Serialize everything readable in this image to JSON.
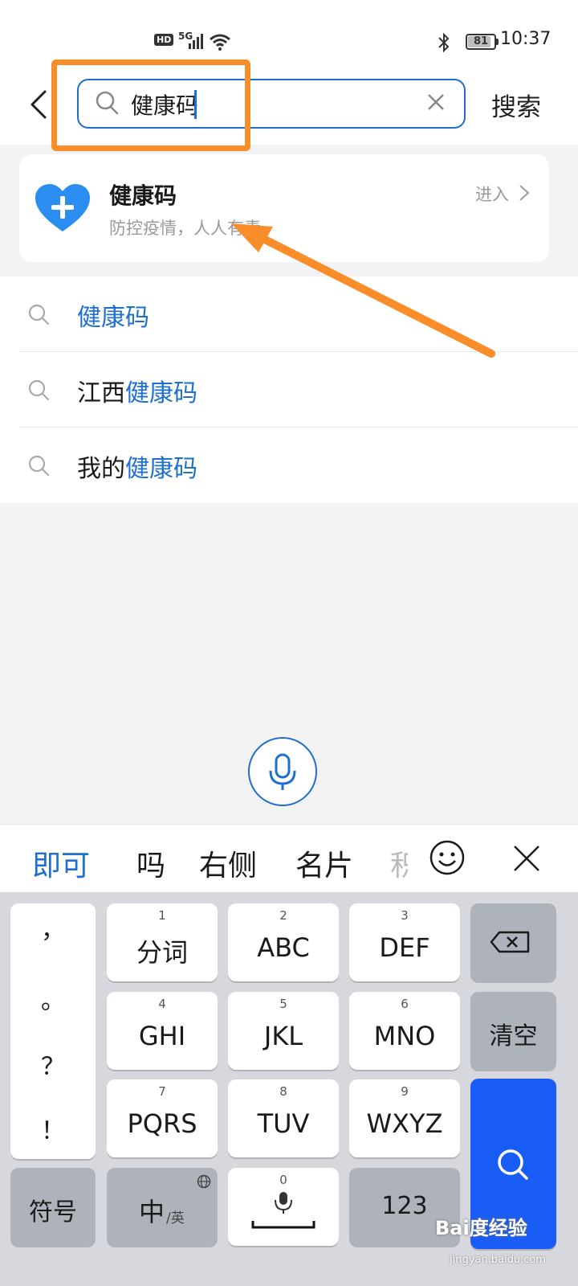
{
  "status_bar": {
    "hd": "HD",
    "network": "5G",
    "battery": "81",
    "battery_level": 0.81,
    "time": "10:37"
  },
  "header": {
    "search_value": "健康码",
    "search_button": "搜索"
  },
  "result_card": {
    "title": "健康码",
    "subtitle": "防控疫情，人人有责",
    "enter_label": "进入",
    "icon": "heart-plus-icon",
    "icon_color": "#2b8df0"
  },
  "suggestions": [
    {
      "prefix": "",
      "highlight": "健康码"
    },
    {
      "prefix": "江西",
      "highlight": "健康码"
    },
    {
      "prefix": "我的",
      "highlight": "健康码"
    }
  ],
  "candidates": [
    "即可",
    "吗",
    "右侧",
    "名片",
    "积"
  ],
  "keyboard": {
    "punct": [
      "，",
      "。",
      "？",
      "！"
    ],
    "keys": [
      {
        "num": "1",
        "label": "分词"
      },
      {
        "num": "2",
        "label": "ABC"
      },
      {
        "num": "3",
        "label": "DEF"
      },
      {
        "num": "4",
        "label": "GHI"
      },
      {
        "num": "5",
        "label": "JKL"
      },
      {
        "num": "6",
        "label": "MNO"
      },
      {
        "num": "7",
        "label": "PQRS"
      },
      {
        "num": "8",
        "label": "TUV"
      },
      {
        "num": "9",
        "label": "WXYZ"
      }
    ],
    "clear": "清空",
    "symbols": "符号",
    "lang_main": "中",
    "lang_sub": "/英",
    "space_num": "0",
    "digits": "123"
  },
  "watermark": {
    "logo": "Bai度经验",
    "url": "jingyan.baidu.com"
  },
  "colors": {
    "accent": "#1e6fd0",
    "annotation": "#f88d2a",
    "search_key": "#1a5df6"
  }
}
